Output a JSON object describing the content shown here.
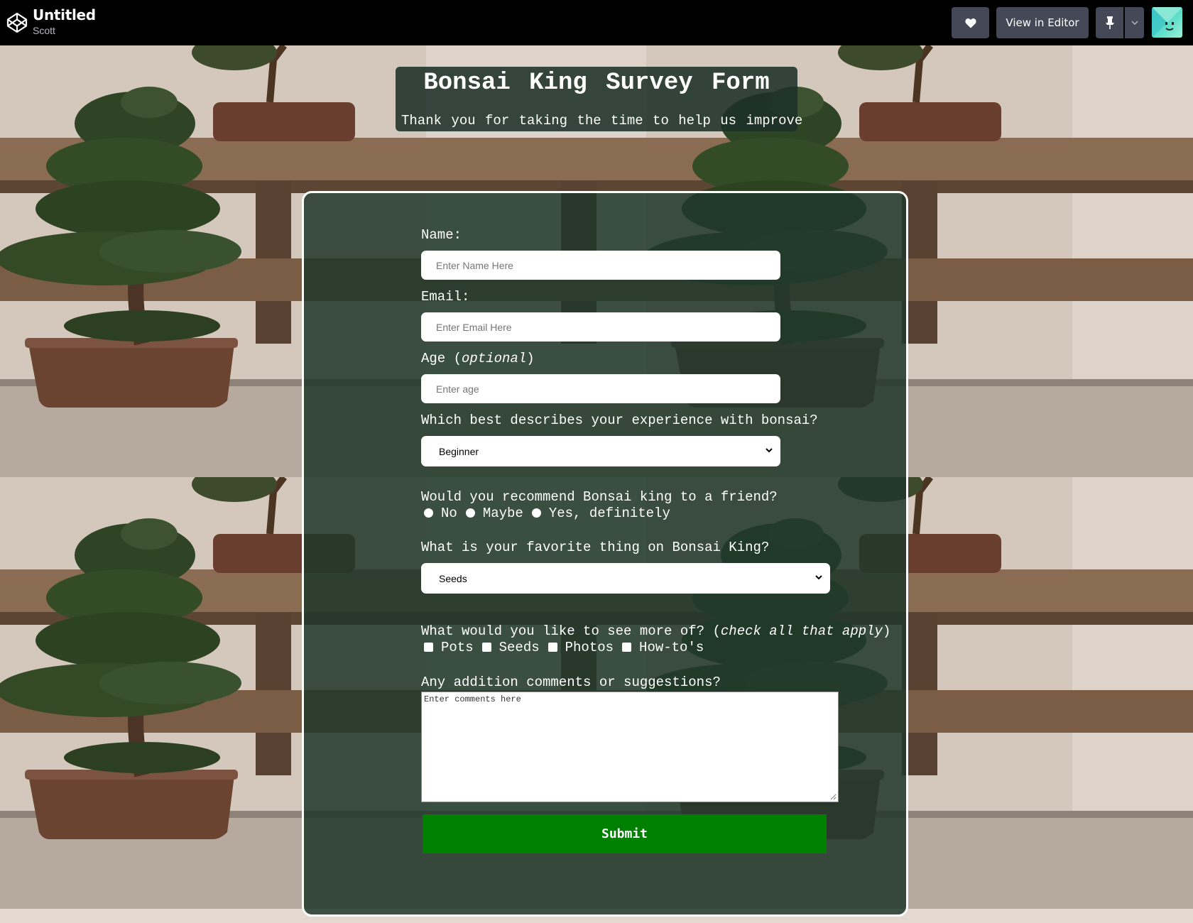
{
  "topbar": {
    "pen_title": "Untitled",
    "author": "Scott",
    "view_in_editor_label": "View in Editor",
    "icons": [
      "codepen-logo-icon",
      "heart-icon",
      "pin-icon",
      "chevron-down-icon",
      "avatar"
    ]
  },
  "header": {
    "title": "Bonsai King Survey Form",
    "description": "Thank you for taking the time to help us improve"
  },
  "form": {
    "name_label": "Name:",
    "name_placeholder": "Enter Name Here",
    "email_label": "Email:",
    "email_placeholder": "Enter Email Here",
    "age_label": "Age",
    "age_optional": "optional",
    "age_placeholder": "Enter age",
    "experience_label": "Which best describes your experience with bonsai?",
    "experience_selected": "Beginner",
    "recommend_label": "Would you recommend Bonsai king to a friend?",
    "recommend_options": [
      "No",
      "Maybe",
      "Yes, definitely"
    ],
    "favorite_label": "What is your favorite thing on Bonsai King?",
    "favorite_selected": "Seeds",
    "more_label": "What would you like to see more of?",
    "more_hint": "check all that apply",
    "more_options": [
      "Pots",
      "Seeds",
      "Photos",
      "How-to's"
    ],
    "comments_label": "Any addition comments or suggestions?",
    "comments_placeholder": "Enter comments here",
    "submit_label": "Submit"
  },
  "colors": {
    "topbar_bg": "#000000",
    "button_bg": "#444857",
    "panel_bg": "#20382a",
    "submit_bg": "#008000",
    "border": "#ffffff"
  }
}
